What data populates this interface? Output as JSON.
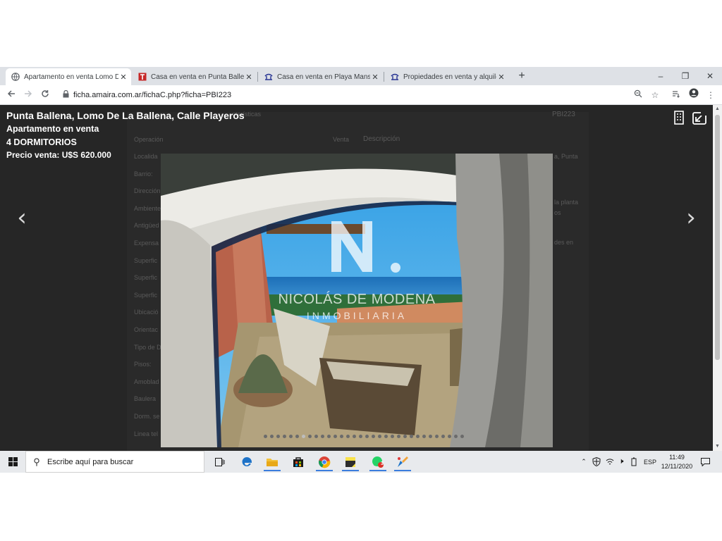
{
  "browser": {
    "tabs": [
      {
        "title": "Apartamento en venta Lomo De",
        "favicon": "globe-icon",
        "active": true
      },
      {
        "title": "Casa en venta en Punta Ballena s",
        "favicon": "amaira-red-icon",
        "active": false
      },
      {
        "title": "Casa en venta en Playa Mansa, P",
        "favicon": "amaira-blue-icon",
        "active": false
      },
      {
        "title": "Propiedades en venta y alquiler",
        "favicon": "amaira-blue-icon",
        "active": false
      }
    ],
    "new_tab": "+",
    "window_controls": {
      "minimize": "–",
      "restore": "❐",
      "close": "✕"
    },
    "url": "ficha.amaira.com.ar/fichaC.php?ficha=PBI223"
  },
  "listing": {
    "address": "Punta Ballena, Lomo De La Ballena, Calle Playeros",
    "type": "Apartamento en venta",
    "bedrooms": "4 DORMITORIOS",
    "price": "Precio venta: U$S 620.000",
    "watermark_logo": "N.",
    "watermark_name": "NICOLÁS DE MODENA",
    "watermark_sub": "INMOBILIARIA",
    "slide_count": 32,
    "active_slide": 6
  },
  "background_page": {
    "code": "PBI223",
    "tab_caracteristicas": "...cterísticas",
    "field_operacion": "Operación",
    "value_operacion": "Venta",
    "descripcion_label": "Descripción",
    "left_fields": [
      "Localida",
      "Barrio:",
      "Dirección",
      "Ambiente",
      "Antigüed",
      "Expensa",
      "Superfic",
      "Superfic",
      "Superfic",
      "Ubicació",
      "Orientac",
      "Tipo de D",
      "Pisos:",
      "Amoblad",
      "Baulera",
      "Dorm. se",
      "Linea tel"
    ],
    "right_snippets": [
      "a, Punta",
      "la planta",
      "os",
      "des en"
    ]
  },
  "taskbar": {
    "search_placeholder": "Escribe aquí para buscar",
    "lang": "ESP",
    "time": "11:49",
    "date": "12/11/2020",
    "whatsapp_badge": "3"
  }
}
